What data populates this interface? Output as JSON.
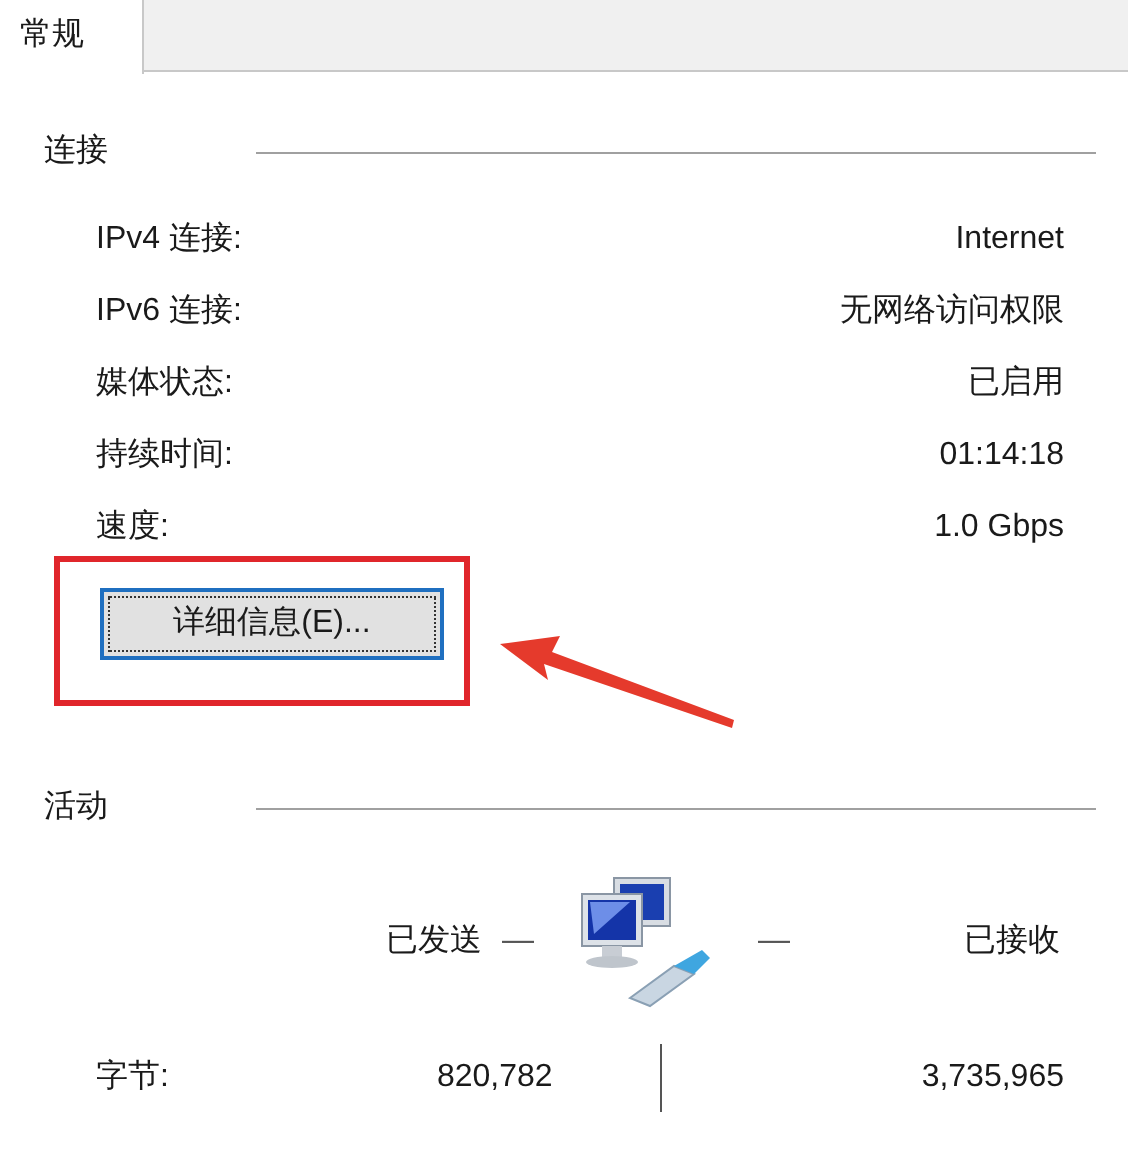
{
  "tabs": [
    {
      "label": "常规",
      "selected": true
    }
  ],
  "connection": {
    "title": "连接",
    "rows": [
      {
        "label": "IPv4 连接:",
        "value": "Internet"
      },
      {
        "label": "IPv6 连接:",
        "value": "无网络访问权限"
      },
      {
        "label": "媒体状态:",
        "value": "已启用"
      },
      {
        "label": "持续时间:",
        "value": "01:14:18"
      },
      {
        "label": "速度:",
        "value": "1.0 Gbps"
      }
    ],
    "details_button": "详细信息(E)..."
  },
  "activity": {
    "title": "活动",
    "sent_label": "已发送",
    "received_label": "已接收",
    "dash_left": "—",
    "dash_right": "—",
    "bytes_label": "字节:",
    "bytes_sent": "820,782",
    "bytes_received": "3,735,965"
  }
}
